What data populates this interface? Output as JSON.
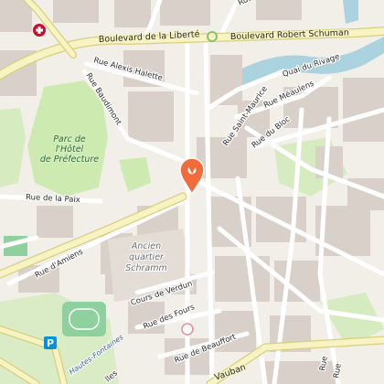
{
  "map": {
    "marker_icon": "map-pin-icon",
    "hospital_icon": "hospital-cross-icon",
    "parking_icon": "parking-icon",
    "parking_symbol": "P",
    "colors": {
      "background": "#f2efe9",
      "building": "#d9d0c9",
      "major_road": "#f7f3c2",
      "major_road_casing": "#d8cf7c",
      "minor_road": "#ffffff",
      "park": "#cdebb0",
      "water": "#aad3df",
      "marker": "#f26b3a",
      "hospital": "#c8102e",
      "parking": "#0092da"
    },
    "labels": {
      "blvd_liberte": "Boulevard de la Liberté",
      "blvd_schuman": "Boulevard Robert Schuman",
      "rue_alexis_halette": "Rue Alexis Halette",
      "rue_baudimont": "Rue Baudimont",
      "quai_rivage": "Quai du Rivage",
      "rue_meaulens": "Rue Méaulens",
      "rue_saint_maurice": "Rue Saint-Maurice",
      "rue_du_bloc": "Rue du Bloc",
      "parc_line1": "Parc de",
      "parc_line2": "l'Hôtel",
      "parc_line3": "de Préfecture",
      "rue_de_la_paix": "Rue de la Paix",
      "rue_amiens": "Rue d'Amiens",
      "ancien_line1": "Ancien",
      "ancien_line2": "quartier",
      "ancien_line3": "Schramm",
      "cours_verdun": "Cours de Verdun",
      "rue_des_fours": "Rue des Fours",
      "rue_beauffort": "Rue de Beauffort",
      "vauban": "Vauban",
      "hautes_fontaines": "Hautes-Fontaines",
      "rue_top": "Rue",
      "rue_br_1": "Rue",
      "rue_br_2": "Rue",
      "partial_lles": "lles"
    }
  }
}
